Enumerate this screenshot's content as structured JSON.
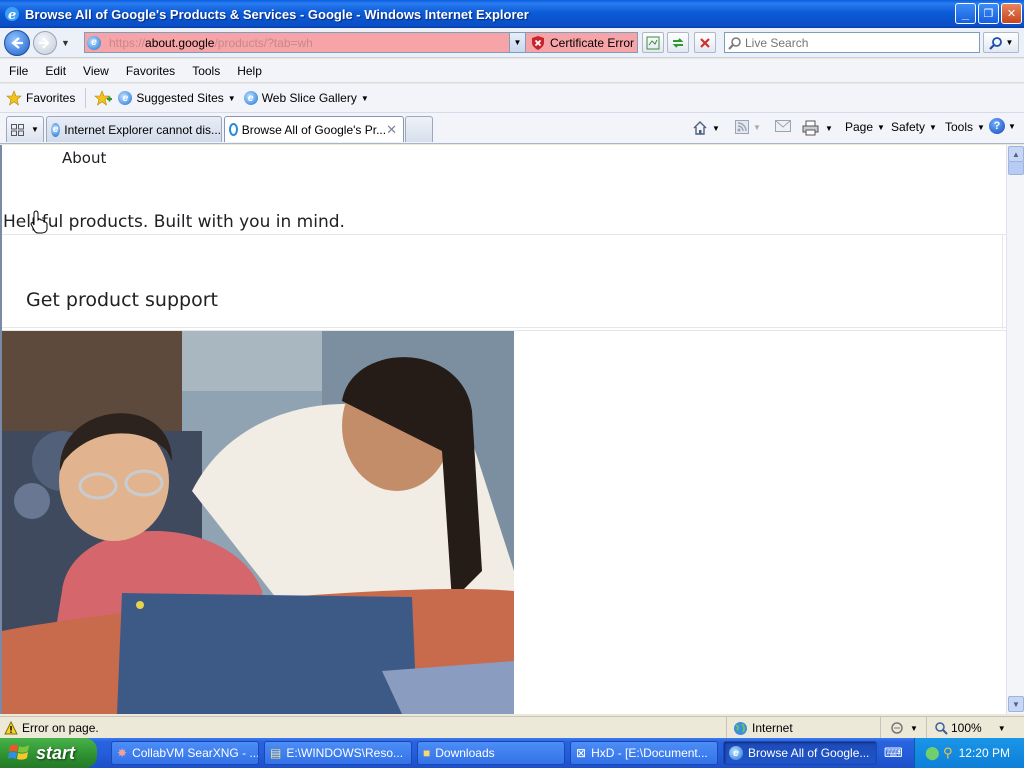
{
  "window": {
    "title": "Browse All of Google's Products & Services - Google - Windows Internet Explorer",
    "minimize": "_",
    "maximize": "❐",
    "close": "✕"
  },
  "address_bar": {
    "url_prefix": "https://",
    "url_domain": "about.google",
    "url_rest": "/products/?tab=wh",
    "certificate_error": "Certificate Error",
    "search_placeholder": "Live Search"
  },
  "menu": [
    "File",
    "Edit",
    "View",
    "Favorites",
    "Tools",
    "Help"
  ],
  "favorites_bar": {
    "favorites_label": "Favorites",
    "suggested_sites": "Suggested Sites",
    "web_slice_gallery": "Web Slice Gallery"
  },
  "tabs": [
    {
      "label": "Internet Explorer cannot dis..."
    },
    {
      "label": "Browse All of Google's Pr..."
    }
  ],
  "command_bar": {
    "page": "Page",
    "safety": "Safety",
    "tools": "Tools"
  },
  "page": {
    "nav_about": "About",
    "tagline": "Helpful products. Built with you in mind.",
    "support_link": "Get product support"
  },
  "status_bar": {
    "message": "Error on page.",
    "zone": "Internet",
    "zoom": "100%"
  },
  "taskbar": {
    "start": "start",
    "tasks": [
      {
        "label": "CollabVM SearXNG - ..."
      },
      {
        "label": "E:\\WINDOWS\\Reso..."
      },
      {
        "label": "Downloads"
      },
      {
        "label": "HxD - [E:\\Document..."
      },
      {
        "label": "Browse All of Google..."
      }
    ],
    "clock": "12:20 PM"
  },
  "colors": {
    "title_bar": "#0b5bd8",
    "address_error": "#f6a4a8",
    "taskbar": "#245edb",
    "start_button": "#2d8f2f"
  }
}
